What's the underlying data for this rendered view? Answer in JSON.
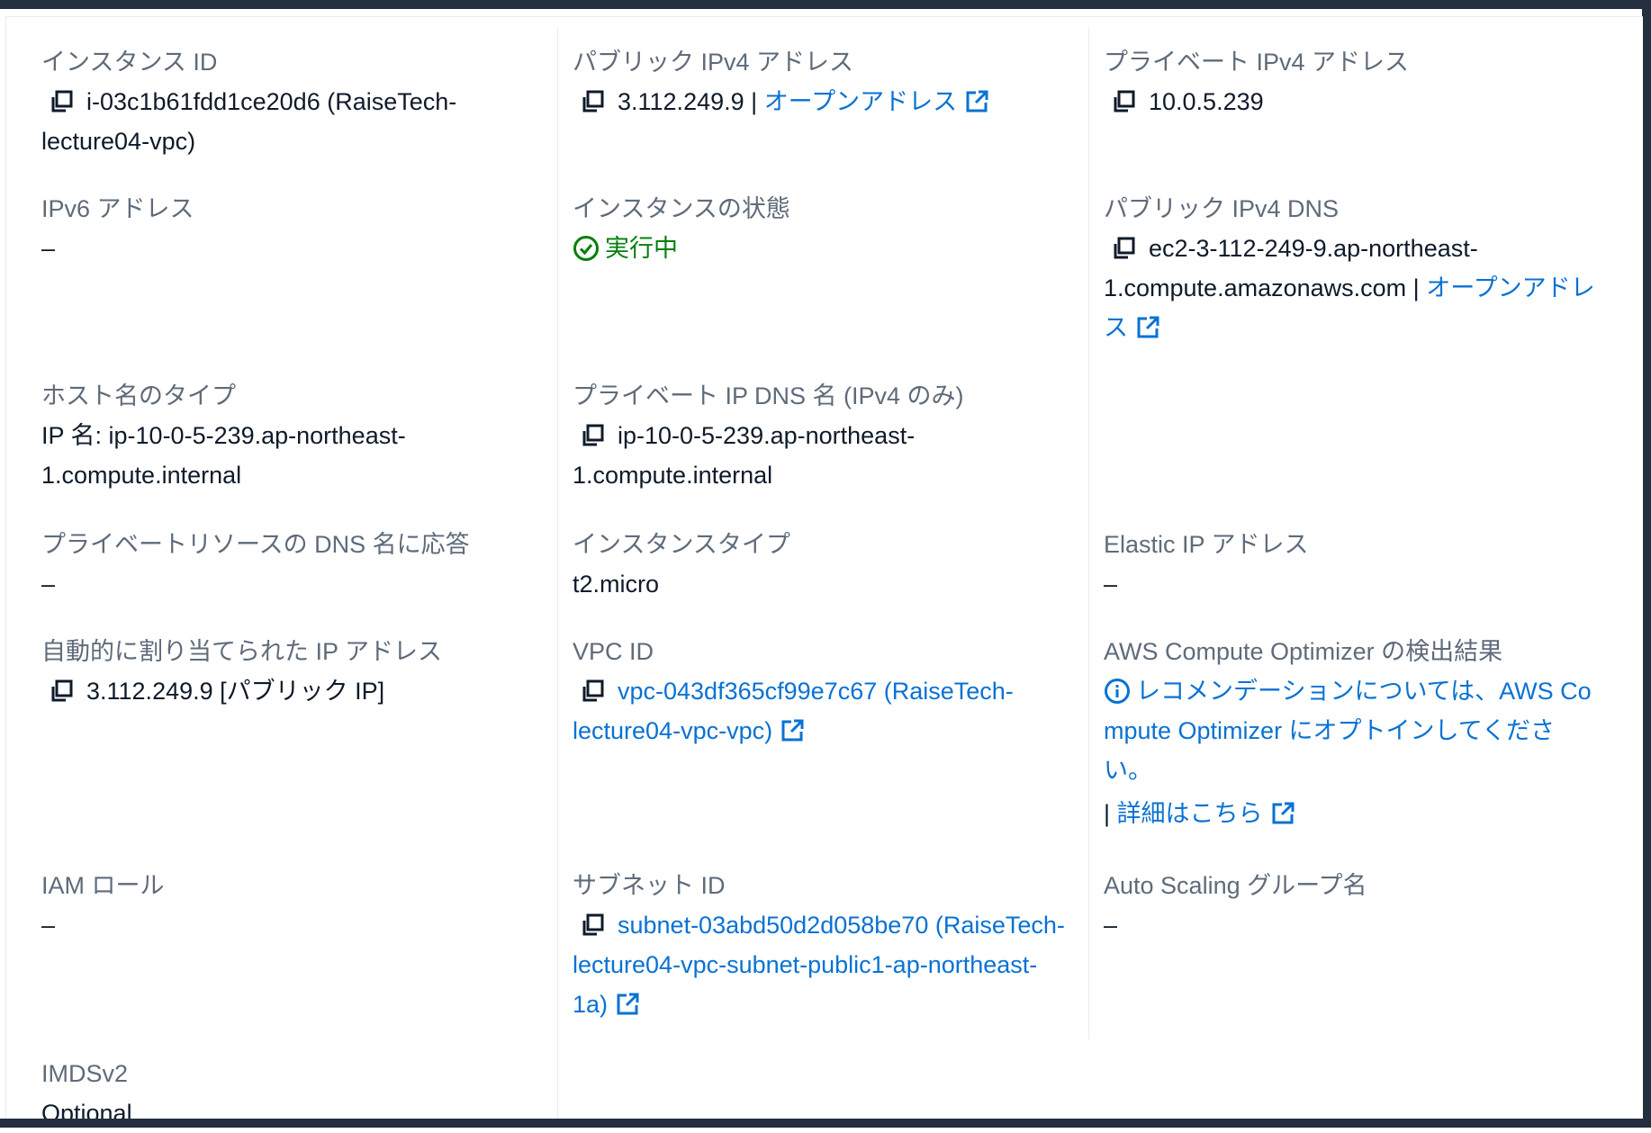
{
  "fields": {
    "instance_id": {
      "label": "インスタンス ID",
      "value": "i-03c1b61fdd1ce20d6 (RaiseTech-lecture04-vpc)"
    },
    "public_ipv4": {
      "label": "パブリック IPv4 アドレス",
      "value": "3.112.249.9",
      "separator": "|",
      "link": "オープンアドレス"
    },
    "private_ipv4": {
      "label": "プライベート IPv4 アドレス",
      "value": "10.0.5.239"
    },
    "ipv6": {
      "label": "IPv6 アドレス",
      "value": "–"
    },
    "instance_state": {
      "label": "インスタンスの状態",
      "value": "実行中"
    },
    "public_dns": {
      "label": "パブリック IPv4 DNS",
      "value": "ec2-3-112-249-9.ap-northeast-1.compute.amazonaws.com",
      "separator": "|",
      "link": "オープンアドレス"
    },
    "hostname_type": {
      "label": "ホスト名のタイプ",
      "value": "IP 名: ip-10-0-5-239.ap-northeast-1.compute.internal"
    },
    "private_dns": {
      "label": "プライベート IP DNS 名 (IPv4 のみ)",
      "value": "ip-10-0-5-239.ap-northeast-1.compute.internal"
    },
    "dns_answer": {
      "label": "プライベートリソースの DNS 名に応答",
      "value": "–"
    },
    "instance_type": {
      "label": "インスタンスタイプ",
      "value": "t2.micro"
    },
    "elastic_ip": {
      "label": "Elastic IP アドレス",
      "value": "–"
    },
    "auto_ip": {
      "label": "自動的に割り当てられた IP アドレス",
      "value": "3.112.249.9 [パブリック IP]"
    },
    "vpc_id": {
      "label": "VPC ID",
      "link": "vpc-043df365cf99e7c67 (RaiseTech-lecture04-vpc-vpc)"
    },
    "compute_optimizer": {
      "label": "AWS Compute Optimizer の検出結果",
      "info_line1": "レコメンデーションについては、AWS Co",
      "info_line2": "mpute Optimizer にオプトインしてくださ",
      "info_line3": "い。",
      "separator": "|",
      "link": "詳細はこちら"
    },
    "iam_role": {
      "label": "IAM ロール",
      "value": "–"
    },
    "subnet_id": {
      "label": "サブネット ID",
      "link": "subnet-03abd50d2d058be70 (RaiseTech-lecture04-vpc-subnet-public1-ap-northeast-1a)"
    },
    "asg_name": {
      "label": "Auto Scaling グループ名",
      "value": "–"
    },
    "imdsv2": {
      "label": "IMDSv2",
      "value": "Optional"
    }
  }
}
